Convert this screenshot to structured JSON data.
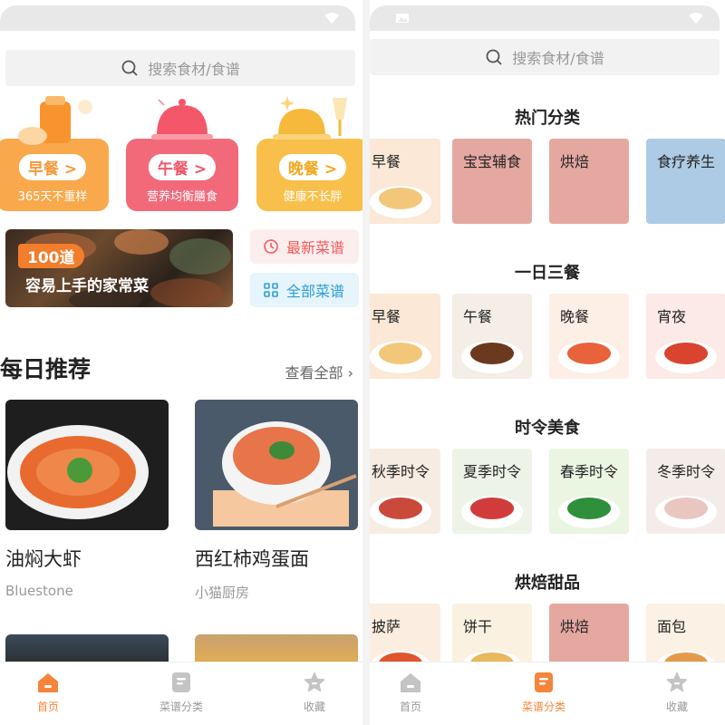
{
  "left": {
    "search": {
      "placeholder": "搜索食材/食谱"
    },
    "meals": [
      {
        "label": "早餐 >",
        "sub": "365天不重样",
        "color": "#f9a94b",
        "top": "#fde3c8"
      },
      {
        "label": "午餐 >",
        "sub": "营养均衡膳食",
        "color": "#f26a7a",
        "top": "#fbd6dc"
      },
      {
        "label": "晚餐 >",
        "sub": "健康不长胖",
        "color": "#f8c04a",
        "top": "#fcebc6"
      }
    ],
    "banner": {
      "badge": "100道",
      "title": "容易上手的家常菜"
    },
    "quick": [
      {
        "label": "最新菜谱",
        "color": "#f25a5a",
        "bg": "#fdeeee"
      },
      {
        "label": "全部菜谱",
        "color": "#2b9fd8",
        "bg": "#e6f4fb"
      }
    ],
    "section": {
      "title": "每日推荐",
      "see_all": "查看全部 ›"
    },
    "recipes": [
      {
        "name": "油焖大虾",
        "author": "Bluestone"
      },
      {
        "name": "西红柿鸡蛋面",
        "author": "小猫厨房"
      }
    ]
  },
  "tabs": [
    {
      "label": "首页",
      "icon": "home-icon"
    },
    {
      "label": "菜谱分类",
      "icon": "recipe-book-icon"
    },
    {
      "label": "收藏",
      "icon": "star-icon"
    }
  ],
  "right": {
    "search": {
      "placeholder": "搜索食材/食谱"
    },
    "groups": [
      {
        "title": "热门分类",
        "items": [
          {
            "label": "早餐",
            "bg": "#fbe8d6",
            "food": "#f3c77a"
          },
          {
            "label": "宝宝辅食",
            "bg": "#e5a8a0",
            "food": ""
          },
          {
            "label": "烘焙",
            "bg": "#e5a8a0",
            "food": ""
          },
          {
            "label": "食疗养生",
            "bg": "#aecbe5",
            "food": ""
          }
        ]
      },
      {
        "title": "一日三餐",
        "items": [
          {
            "label": "早餐",
            "bg": "#fbe8d6",
            "food": "#f3c77a"
          },
          {
            "label": "午餐",
            "bg": "#f5eee6",
            "food": "#6b3a1e"
          },
          {
            "label": "晚餐",
            "bg": "#fdeee6",
            "food": "#e8623a"
          },
          {
            "label": "宵夜",
            "bg": "#fbeae6",
            "food": "#d9442e"
          }
        ]
      },
      {
        "title": "时令美食",
        "items": [
          {
            "label": "秋季时令",
            "bg": "#f7ece2",
            "food": "#c94a3a"
          },
          {
            "label": "夏季时令",
            "bg": "#eef3e8",
            "food": "#d23b3b"
          },
          {
            "label": "春季时令",
            "bg": "#eaf5e2",
            "food": "#2f8f3a"
          },
          {
            "label": "冬季时令",
            "bg": "#f4ece8",
            "food": "#e9c7c0"
          }
        ]
      },
      {
        "title": "烘焙甜品",
        "items": [
          {
            "label": "披萨",
            "bg": "#fbeee0",
            "food": "#e0542e"
          },
          {
            "label": "饼干",
            "bg": "#fbf1e0",
            "food": "#e8b85a"
          },
          {
            "label": "烘焙",
            "bg": "#e5a8a0",
            "food": ""
          },
          {
            "label": "面包",
            "bg": "#fbf1e4",
            "food": "#e59a4a"
          }
        ]
      }
    ]
  },
  "colors": {
    "accent": "#f5853a",
    "inactive": "#999999"
  }
}
